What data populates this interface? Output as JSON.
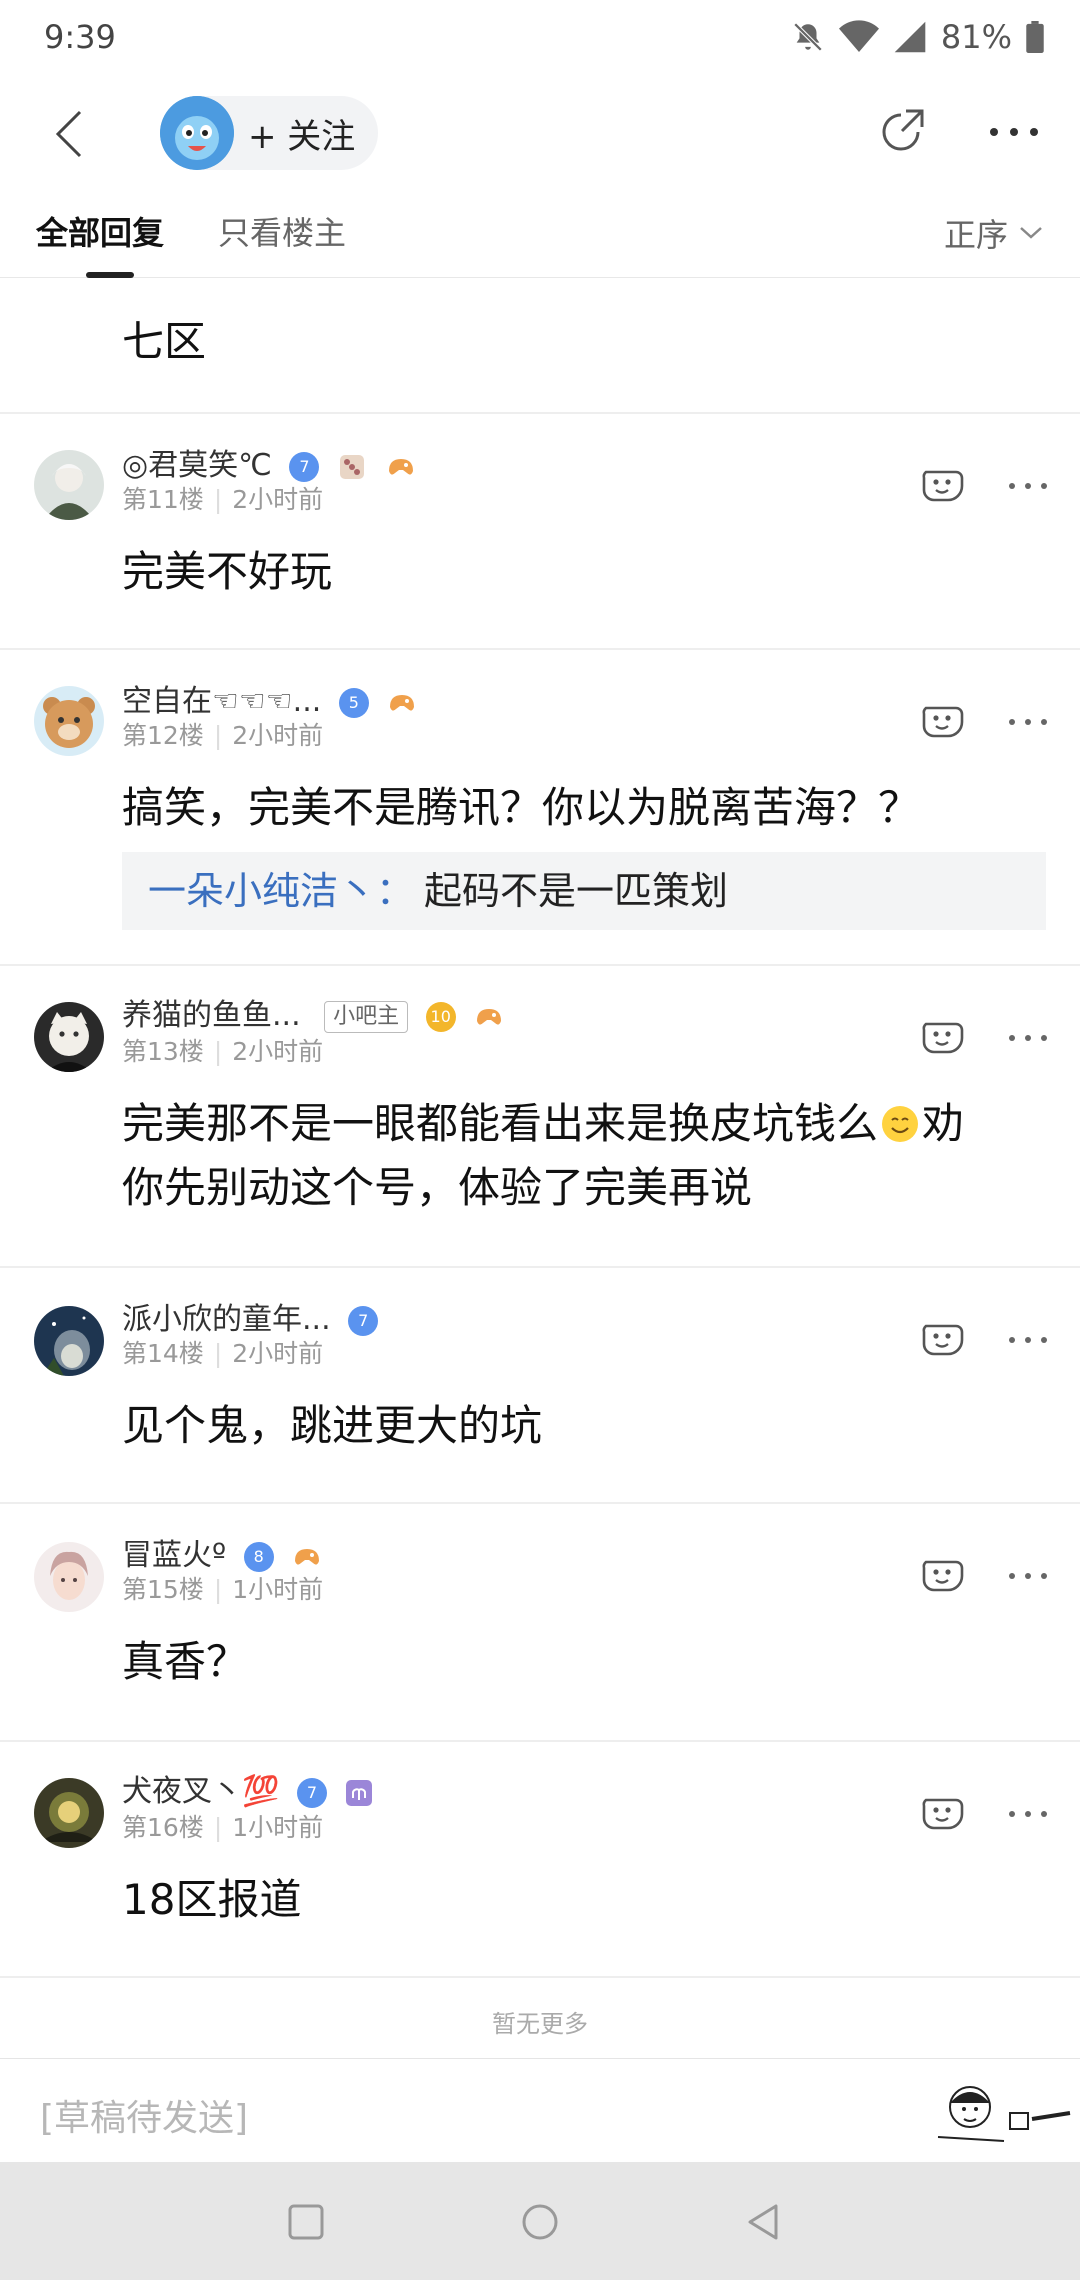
{
  "status_bar": {
    "time": "9:39",
    "battery": "81%"
  },
  "header": {
    "follow_label": "+ 关注"
  },
  "tabs": {
    "all": "全部回复",
    "op_only": "只看楼主",
    "sort": "正序"
  },
  "posts": [
    {
      "content": "七区"
    },
    {
      "username": "◎君莫笑℃",
      "level": "7",
      "floor": "第11楼",
      "time": "2小时前",
      "content": "完美不好玩"
    },
    {
      "username": "空自在☜☜☜...",
      "level": "5",
      "floor": "第12楼",
      "time": "2小时前",
      "content": "搞笑，完美不是腾讯？你以为脱离苦海？？",
      "quote_user": "一朵小纯洁丶：",
      "quote_text": "起码不是一匹策划"
    },
    {
      "username": "养猫的鱼鱼...",
      "tag": "小吧主",
      "level": "10",
      "floor": "第13楼",
      "time": "2小时前",
      "content_line1": "完美那不是一眼都能看出来是换皮坑钱么",
      "content_line1_end": "劝",
      "content_line2": "你先别动这个号，体验了完美再说"
    },
    {
      "username": "派小欣的童年...",
      "level": "7",
      "floor": "第14楼",
      "time": "2小时前",
      "content": "见个鬼，跳进更大的坑"
    },
    {
      "username": "冒蓝火º",
      "level": "8",
      "floor": "第15楼",
      "time": "1小时前",
      "content": "真香？"
    },
    {
      "username": "犬夜叉丶💯",
      "level": "7",
      "floor": "第16楼",
      "time": "1小时前",
      "content": "18区报道"
    }
  ],
  "no_more": "暂无更多",
  "draft": "[草稿待发送]",
  "icons": {
    "back": "chevron-left-icon",
    "share": "share-icon",
    "more": "more-dots-icon",
    "reply": "reply-face-icon",
    "nav_recent": "square-icon",
    "nav_home": "circle-icon",
    "nav_back": "triangle-back-icon"
  },
  "colors": {
    "accent": "#3a6fbf",
    "level_badge": "#5a93ef",
    "level_badge_gold": "#f3b62b"
  }
}
